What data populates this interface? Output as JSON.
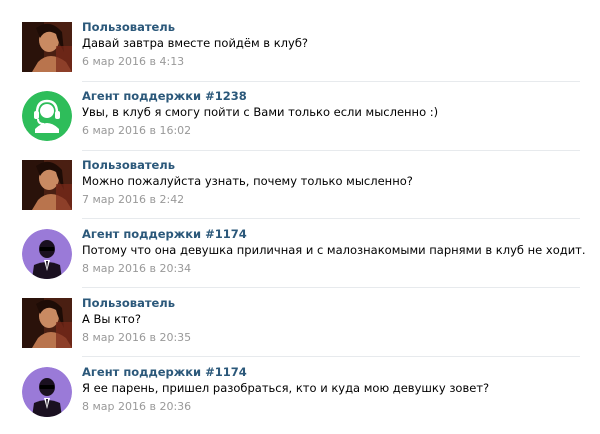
{
  "messages": [
    {
      "author": "Пользователь",
      "text": "Давай завтра вместе пойдём в клуб?",
      "date": "6 мар 2016 в 4:13",
      "avatar": "user-photo-avatar"
    },
    {
      "author": "Агент поддержки #1238",
      "text": "Увы, в клуб я смогу пойти с Вами только если мысленно :)",
      "date": "6 мар 2016 в 16:02",
      "avatar": "support-agent-green-avatar"
    },
    {
      "author": "Пользователь",
      "text": "Можно пожалуйста узнать, почему только мысленно?",
      "date": "7 мар 2016 в 2:42",
      "avatar": "user-photo-avatar"
    },
    {
      "author": "Агент поддержки #1174",
      "text": "Потому что она девушка приличная и с малознакомыми парнями в клуб не ходит.",
      "date": "8 мар 2016 в 20:34",
      "avatar": "support-agent-purple-avatar"
    },
    {
      "author": "Пользователь",
      "text": "А Вы кто?",
      "date": "8 мар 2016 в 20:35",
      "avatar": "user-photo-avatar"
    },
    {
      "author": "Агент поддержки #1174",
      "text": "Я ее парень, пришел разобраться, кто и куда мою девушку зовет?",
      "date": "8 мар 2016 в 20:36",
      "avatar": "support-agent-purple-avatar"
    }
  ],
  "colors": {
    "author_link": "#2b587a",
    "date_gray": "#999999",
    "agent_green": "#2ebd5a",
    "agent_purple": "#9a7ad8",
    "divider": "#e7eaed"
  }
}
